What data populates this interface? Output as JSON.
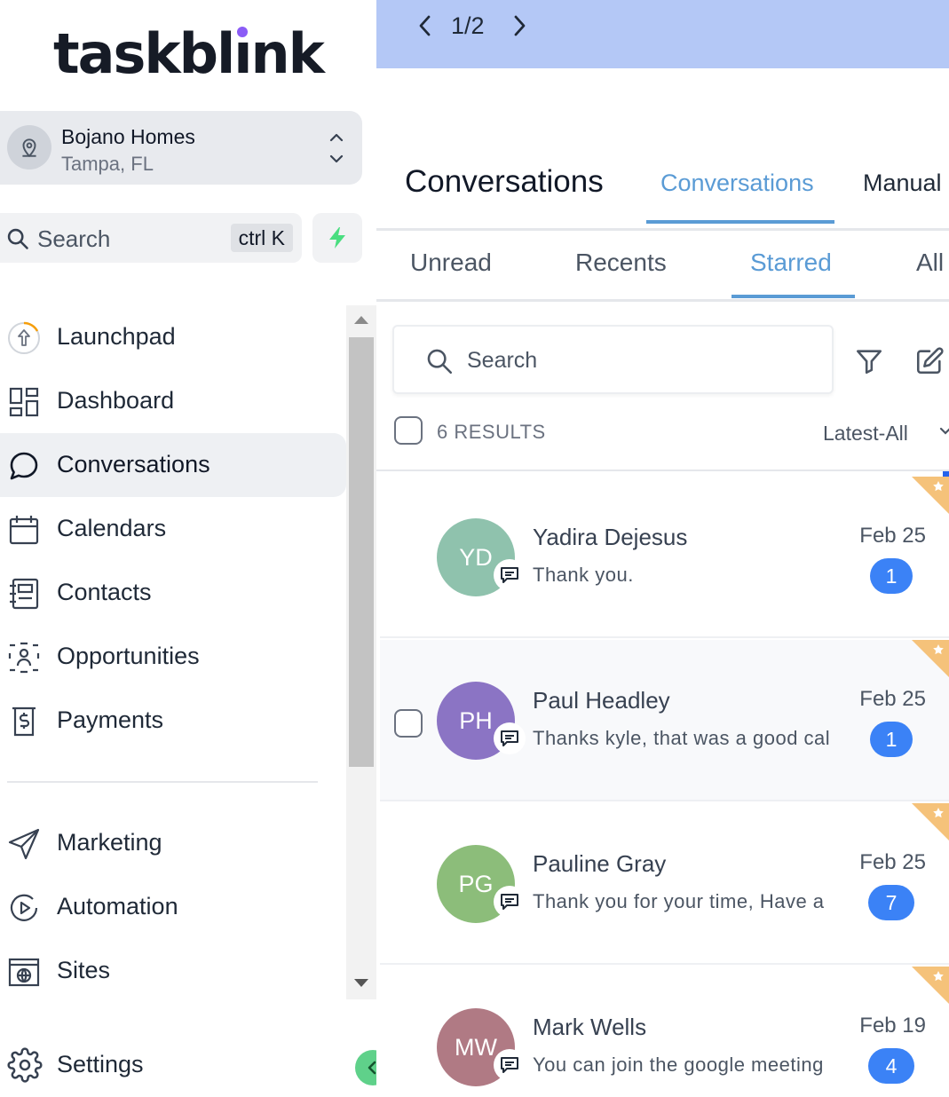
{
  "brand": {
    "logo_text_a": "task",
    "logo_text_b": "bl",
    "logo_text_i": "ı",
    "logo_text_c": "nk",
    "accent_dot": "#8b5cf6"
  },
  "location": {
    "name": "Bojano Homes",
    "city": "Tampa, FL"
  },
  "sidebar_search": {
    "label": "Search",
    "shortcut": "ctrl K"
  },
  "nav": [
    {
      "label": "Launchpad",
      "icon": "rocket-icon"
    },
    {
      "label": "Dashboard",
      "icon": "dashboard-icon"
    },
    {
      "label": "Conversations",
      "icon": "chat-icon",
      "active": true
    },
    {
      "label": "Calendars",
      "icon": "calendar-icon"
    },
    {
      "label": "Contacts",
      "icon": "contacts-icon"
    },
    {
      "label": "Opportunities",
      "icon": "opportunities-icon"
    },
    {
      "label": "Payments",
      "icon": "payments-icon"
    },
    {
      "label": "Marketing",
      "icon": "send-icon"
    },
    {
      "label": "Automation",
      "icon": "automation-icon"
    },
    {
      "label": "Sites",
      "icon": "globe-icon"
    }
  ],
  "settings": {
    "label": "Settings",
    "icon": "gear-icon"
  },
  "pager": {
    "text": "1/2"
  },
  "header": {
    "title": "Conversations",
    "tabs": [
      "Conversations",
      "Manual"
    ],
    "active_tab": "Conversations"
  },
  "sub_tabs": [
    "Unread",
    "Recents",
    "Starred",
    "All"
  ],
  "active_sub_tab": "Starred",
  "list_search": {
    "placeholder": "Search"
  },
  "results": {
    "count_text": "6 RESULTS",
    "sort": "Latest-All"
  },
  "conversations": [
    {
      "initials": "YD",
      "name": "Yadira Dejesus",
      "preview": "Thank you.",
      "date": "Feb 25",
      "unread": "1",
      "avatar_color": "#8fc2ad",
      "starred": true
    },
    {
      "initials": "PH",
      "name": "Paul Headley",
      "preview": "Thanks kyle, that was a good call",
      "date": "Feb 25",
      "unread": "1",
      "avatar_color": "#8b74c4",
      "starred": true
    },
    {
      "initials": "PG",
      "name": "Pauline Gray",
      "preview": "Thank you for your time, Have a great day",
      "date": "Feb 25",
      "unread": "7",
      "avatar_color": "#8cbd7a",
      "starred": true
    },
    {
      "initials": "MW",
      "name": "Mark Wells",
      "preview": "You can join the google meeting",
      "date": "Feb 19",
      "unread": "4",
      "avatar_color": "#b07a84",
      "starred": true
    }
  ],
  "colors": {
    "accent": "#5a9bd5",
    "pager_bg": "#b4c8f6",
    "badge": "#3b82f6",
    "star": "#f5c27a",
    "collapse": "#5fd18a"
  }
}
